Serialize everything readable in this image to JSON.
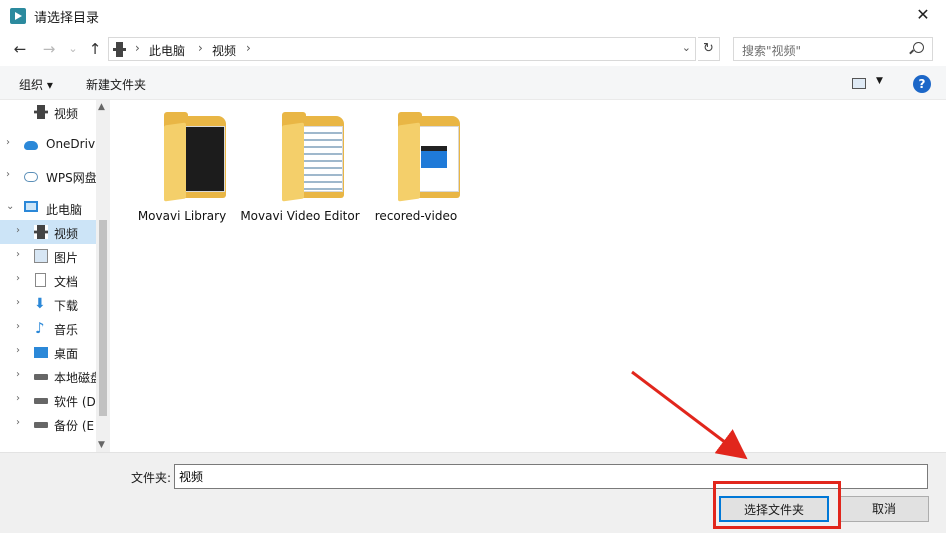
{
  "window": {
    "title": "请选择目录",
    "close_glyph": "✕",
    "icon": "app-play-icon"
  },
  "nav": {
    "back_glyph": "←",
    "forward_glyph": "→",
    "recent_glyph": "⌄",
    "up_glyph": "↑",
    "breadcrumb": [
      "此电脑",
      "视频"
    ],
    "separator": "›",
    "refresh_glyph": "↻",
    "search_placeholder": "搜索\"视频\""
  },
  "toolbar": {
    "organize_label": "组织 ▾",
    "new_folder_label": "新建文件夹",
    "help_glyph": "?",
    "view_dd_glyph": "▼"
  },
  "sidebar": {
    "items": [
      {
        "label": "视频",
        "icon": "video-icon",
        "chev": ""
      },
      {
        "label": "OneDriv",
        "icon": "onedrive-cloud-icon",
        "chev": "›"
      },
      {
        "label": "WPS网盘",
        "icon": "wps-cloud-icon",
        "chev": "›"
      },
      {
        "label": "此电脑",
        "icon": "this-pc-icon",
        "chev": "⌄"
      },
      {
        "label": "视频",
        "icon": "video-icon",
        "chev": "›"
      },
      {
        "label": "图片",
        "icon": "pictures-icon",
        "chev": "›"
      },
      {
        "label": "文档",
        "icon": "documents-icon",
        "chev": "›"
      },
      {
        "label": "下载",
        "icon": "download-icon",
        "chev": "›"
      },
      {
        "label": "音乐",
        "icon": "music-icon",
        "chev": "›"
      },
      {
        "label": "桌面",
        "icon": "desktop-icon",
        "chev": "›"
      },
      {
        "label": "本地磁盘",
        "icon": "local-disk-icon",
        "chev": "›"
      },
      {
        "label": "软件 (D",
        "icon": "drive-icon",
        "chev": "›"
      },
      {
        "label": "备份 (E",
        "icon": "drive-icon",
        "chev": "›"
      }
    ],
    "selected_index": 4,
    "scroll_up": "▲",
    "scroll_down": "▼"
  },
  "folders": [
    {
      "name": "Movavi Library",
      "thumb": "dark"
    },
    {
      "name": "Movavi Video Editor",
      "thumb": "doc"
    },
    {
      "name": "recored-video",
      "thumb": "clapper"
    }
  ],
  "footer": {
    "folder_label": "文件夹:",
    "folder_value": "视频",
    "select_button": "选择文件夹",
    "cancel_button": "取消"
  },
  "colors": {
    "accent": "#0078d7",
    "selection": "#cce4f7",
    "annotation": "#e1261c",
    "folder": "#e9b645"
  }
}
